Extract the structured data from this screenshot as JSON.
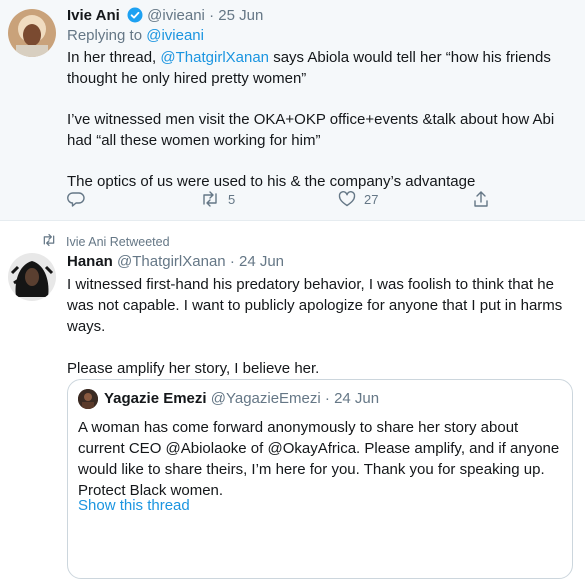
{
  "tweet1": {
    "name": "Ivie Ani",
    "handle": "@ivieani",
    "separator": "·",
    "time": "25 Jun",
    "replying_label": "Replying to",
    "replying_handle": "@ivieani",
    "text_prefix": "In her thread, ",
    "text_mention": "@ThatgirlXanan",
    "text_suffix": " says Abiola would tell her “how his friends thought he only hired pretty women”",
    "paragraph2": "I’ve witnessed men visit the OKA+OKP office+events &talk about how Abi had “all these women working for him”",
    "paragraph3": "The optics of us were used to his & the company’s advantage",
    "actions": {
      "reply_icon": "reply-icon",
      "retweet_icon": "retweet-icon",
      "retweet_count": "5",
      "like_icon": "heart-icon",
      "like_count": "27",
      "share_icon": "share-icon"
    }
  },
  "tweet2": {
    "retweet_note": "Ivie Ani Retweeted",
    "name": "Hanan",
    "handle": "@ThatgirlXanan",
    "separator": "·",
    "time": "24 Jun",
    "paragraph1": "I witnessed first-hand his predatory behavior, I was foolish to think that he was not capable. I want to publicly apologize for anyone that I put in harms ways.",
    "paragraph2": "Please amplify her story, I believe her.",
    "quote": {
      "name": "Yagazie Emezi",
      "handle": "@YagazieEmezi",
      "separator": "·",
      "time": "24 Jun",
      "text": "A woman has come forward anonymously to share her story about current CEO @Abiolaoke of @OkayAfrica. Please amplify, and if anyone would like to share theirs, I’m here for you. Thank you for speaking up. Protect Black women.",
      "show_thread": "Show this thread"
    }
  },
  "colors": {
    "accent": "#1b95e0",
    "muted": "#657786",
    "highlight_bg": "#f5f8fa",
    "border": "#e6ecf0"
  }
}
